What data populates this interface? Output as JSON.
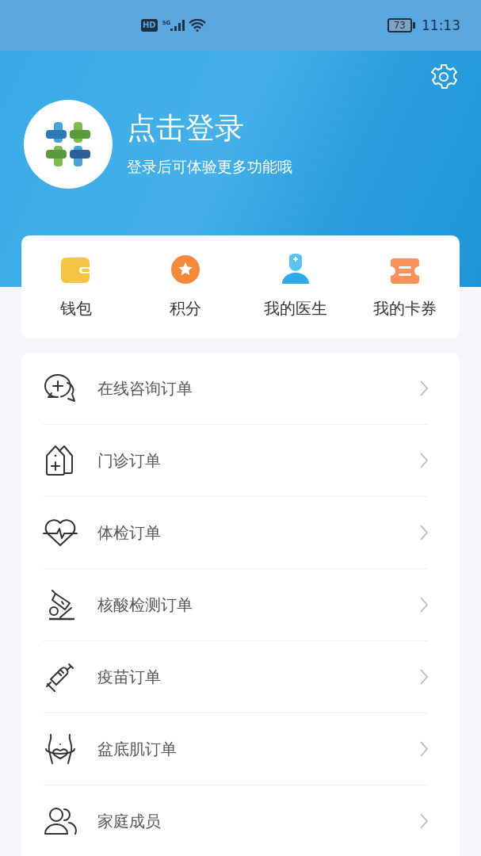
{
  "status_bar": {
    "hd": "HD",
    "network": "5G",
    "battery": "73",
    "time": "11:13"
  },
  "profile": {
    "title": "点击登录",
    "subtitle": "登录后可体验更多功能哦"
  },
  "quick_actions": [
    {
      "label": "钱包"
    },
    {
      "label": "积分"
    },
    {
      "label": "我的医生"
    },
    {
      "label": "我的卡券"
    }
  ],
  "menu": [
    {
      "label": "在线咨询订单"
    },
    {
      "label": "门诊订单"
    },
    {
      "label": "体检订单"
    },
    {
      "label": "核酸检测订单"
    },
    {
      "label": "疫苗订单"
    },
    {
      "label": "盆底肌订单"
    },
    {
      "label": "家庭成员"
    }
  ]
}
